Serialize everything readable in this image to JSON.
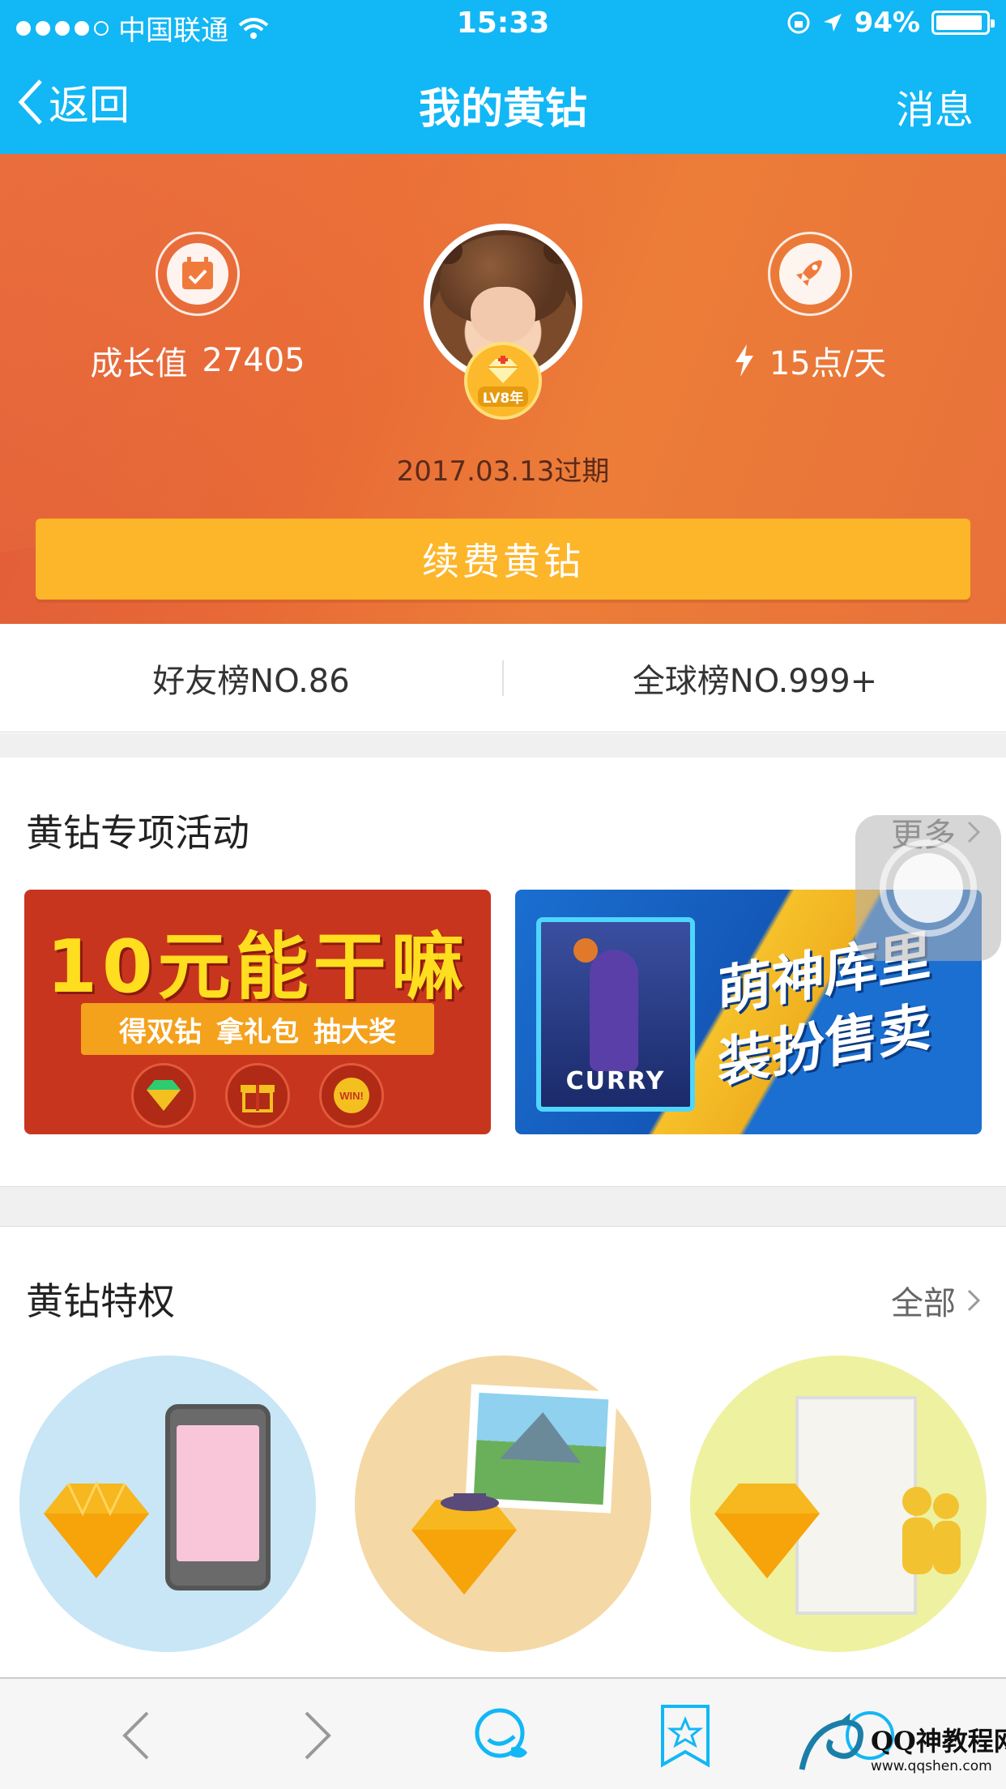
{
  "status_bar": {
    "carrier": "中国联通",
    "time": "15:33",
    "battery": "94%",
    "battery_level": 0.94,
    "signal_bars_filled": 4
  },
  "nav": {
    "back_label": "返回",
    "title": "我的黄钻",
    "message_label": "消息"
  },
  "hero": {
    "growth_label": "成长值",
    "growth_value": "27405",
    "speed_label": "15点/天",
    "badge_label": "LV8年",
    "expire_text": "2017.03.13过期",
    "renew_label": "续费黄钻"
  },
  "ranks": {
    "friends": "好友榜NO.86",
    "global": "全球榜NO.999+"
  },
  "activities": {
    "title": "黄钻专项活动",
    "more_label": "更多",
    "banners": [
      {
        "headline": "10元能干嘛",
        "tags": [
          "得双钻",
          "拿礼包",
          "抽大奖"
        ],
        "win_label": "WIN!"
      },
      {
        "card_name": "CURRY",
        "slogan_line1": "萌神库里",
        "slogan_line2": "装扮售卖"
      }
    ]
  },
  "privileges": {
    "title": "黄钻特权",
    "all_label": "全部"
  },
  "watermark": {
    "text": "QQ神教程网",
    "url": "www.qqshen.com"
  },
  "colors": {
    "brand_blue": "#12b7f5",
    "hero_orange": "#e86a36",
    "gold": "#fdb52a"
  }
}
